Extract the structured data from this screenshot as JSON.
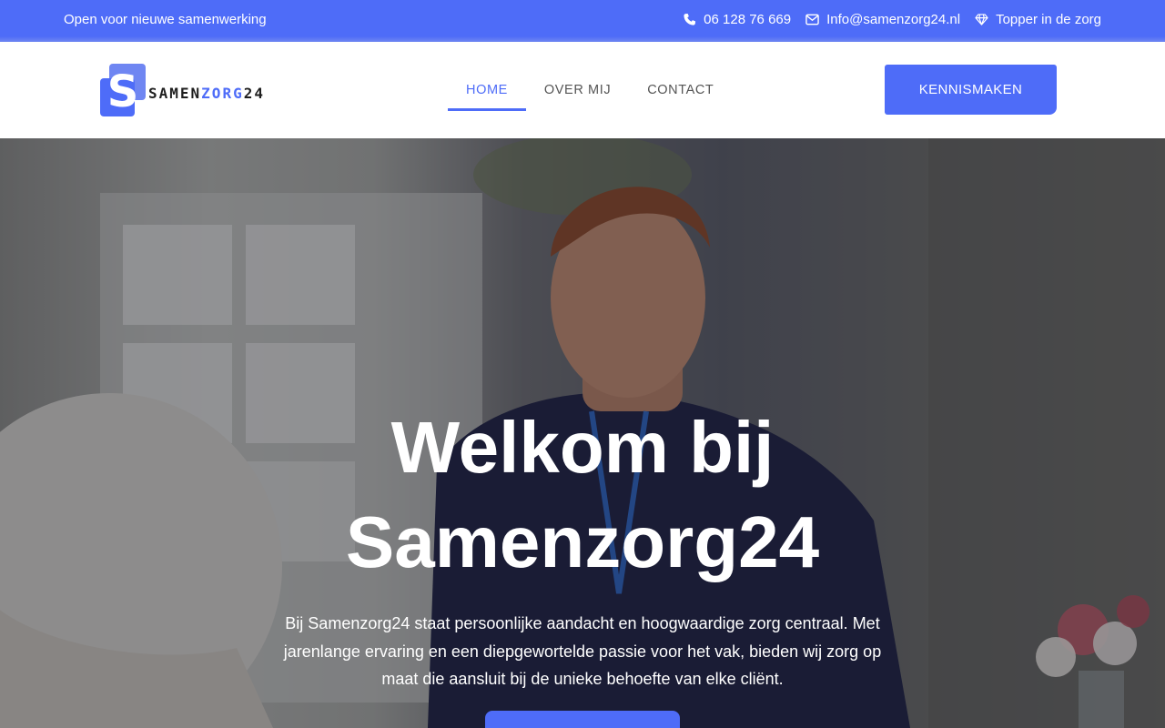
{
  "topbar": {
    "tagline": "Open voor nieuwe samenwerking",
    "phone": "06 128 76 669",
    "email": "Info@samenzorg24.nl",
    "badge": "Topper in de zorg",
    "icons": [
      "phone-icon",
      "envelope-icon",
      "diamond-icon"
    ]
  },
  "logo": {
    "mark": "S",
    "text_dark": "SAMEN",
    "text_accent": "ZORG",
    "text_end": "24"
  },
  "nav": {
    "items": [
      {
        "label": "HOME",
        "active": true
      },
      {
        "label": "OVER MIJ",
        "active": false
      },
      {
        "label": "CONTACT",
        "active": false
      }
    ],
    "cta_label": "KENNISMAKEN"
  },
  "hero": {
    "title_line1": "Welkom bij",
    "title_line2": "Samenzorg24",
    "subtitle": "Bij Samenzorg24 staat persoonlijke aandacht en hoogwaardige zorg centraal. Met jarenlange ervaring en een diepgewortelde passie voor het vak, bieden wij zorg op maat die aansluit bij de unieke behoefte van elke cliënt."
  },
  "colors": {
    "accent": "#4e6cf8",
    "white": "#ffffff",
    "nav_text": "#555555"
  }
}
